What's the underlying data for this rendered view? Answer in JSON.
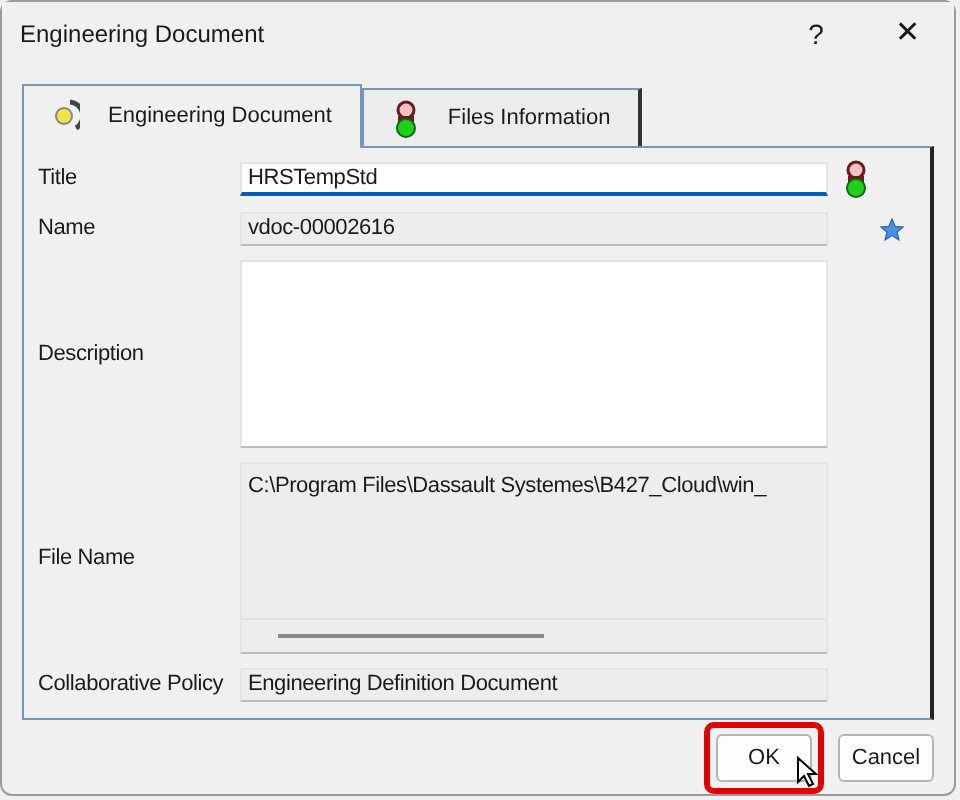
{
  "window": {
    "title": "Engineering Document",
    "help": "?",
    "close": "✕"
  },
  "tabs": [
    {
      "label": "Engineering Document",
      "selected": true
    },
    {
      "label": "Files Information",
      "selected": false
    }
  ],
  "fields": [
    {
      "label": "Title",
      "value": "HRSTempStd",
      "kind": "line",
      "focused": true
    },
    {
      "label": "Name",
      "value": "vdoc-00002616",
      "kind": "line",
      "focused": false
    },
    {
      "label": "Description",
      "kind": "area",
      "focused": false
    },
    {
      "label": "File Name",
      "value": "C:\\Program Files\\Dassault Systemes\\B427_Cloud\\win_",
      "kind": "scroll",
      "focused": false
    },
    {
      "label": "Collaborative Policy",
      "value": "Engineering Definition Document",
      "kind": "line",
      "focused": false
    }
  ],
  "buttons": [
    {
      "label": "OK",
      "highlighted": true
    },
    {
      "label": "Cancel",
      "highlighted": false
    }
  ]
}
